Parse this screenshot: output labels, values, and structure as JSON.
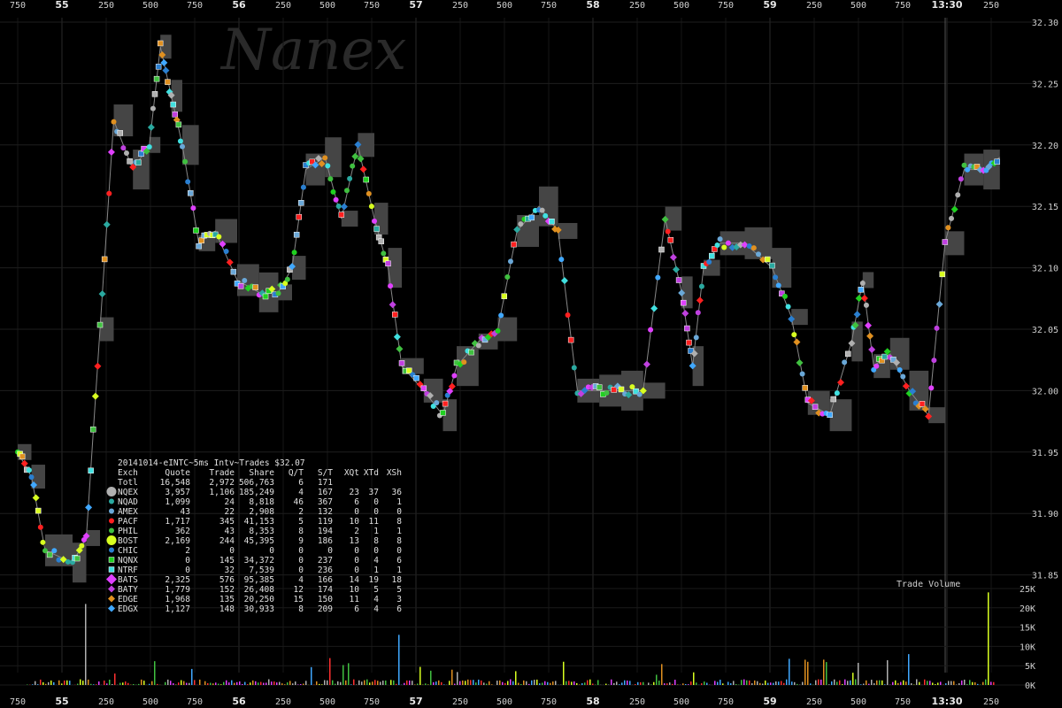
{
  "watermark": "Nanex",
  "chart_data": {
    "type": "scatter",
    "title": "20141014-eINTC~5ms Intv~Trades $32.07",
    "x_axis": {
      "tick_labels": [
        "750",
        "55",
        "250",
        "500",
        "750",
        "56",
        "250",
        "500",
        "750",
        "57",
        "250",
        "500",
        "750",
        "58",
        "250",
        "500",
        "750",
        "59",
        "250",
        "500",
        "750",
        "13:30",
        "250"
      ],
      "major_ticks": [
        "55",
        "56",
        "57",
        "58",
        "59",
        "13:30"
      ]
    },
    "y_axis": {
      "ylim": [
        31.83,
        32.31
      ],
      "tick_labels": [
        "32.30",
        "32.25",
        "32.20",
        "32.15",
        "32.10",
        "32.05",
        "32.00",
        "31.95",
        "31.90",
        "31.85"
      ]
    },
    "volume_panel": {
      "label": "Trade Volume",
      "tick_labels": [
        "25K",
        "20K",
        "15K",
        "10K",
        "5K",
        "0K"
      ],
      "ylim": [
        0,
        25000
      ]
    },
    "price_path": [
      [
        0,
        31.95
      ],
      [
        5,
        31.93
      ],
      [
        10,
        31.87
      ],
      [
        20,
        31.86
      ],
      [
        25,
        31.88
      ],
      [
        30,
        32.05
      ],
      [
        35,
        32.22
      ],
      [
        42,
        32.18
      ],
      [
        48,
        32.2
      ],
      [
        52,
        32.28
      ],
      [
        56,
        32.24
      ],
      [
        60,
        32.2
      ],
      [
        66,
        32.12
      ],
      [
        72,
        32.13
      ],
      [
        80,
        32.09
      ],
      [
        88,
        32.08
      ],
      [
        95,
        32.08
      ],
      [
        100,
        32.1
      ],
      [
        105,
        32.18
      ],
      [
        112,
        32.19
      ],
      [
        118,
        32.14
      ],
      [
        124,
        32.2
      ],
      [
        130,
        32.14
      ],
      [
        135,
        32.1
      ],
      [
        140,
        32.02
      ],
      [
        148,
        32.0
      ],
      [
        155,
        31.98
      ],
      [
        160,
        32.02
      ],
      [
        168,
        32.04
      ],
      [
        175,
        32.05
      ],
      [
        182,
        32.13
      ],
      [
        190,
        32.15
      ],
      [
        197,
        32.13
      ],
      [
        204,
        32.0
      ],
      [
        212,
        32.0
      ],
      [
        220,
        32.0
      ],
      [
        228,
        32.0
      ],
      [
        236,
        32.14
      ],
      [
        242,
        32.08
      ],
      [
        246,
        32.02
      ],
      [
        250,
        32.1
      ],
      [
        256,
        32.12
      ],
      [
        265,
        32.12
      ],
      [
        275,
        32.1
      ],
      [
        282,
        32.06
      ],
      [
        288,
        31.99
      ],
      [
        296,
        31.98
      ],
      [
        304,
        32.04
      ],
      [
        308,
        32.09
      ],
      [
        312,
        32.02
      ],
      [
        318,
        32.03
      ],
      [
        325,
        32.0
      ],
      [
        332,
        31.98
      ],
      [
        338,
        32.12
      ],
      [
        345,
        32.18
      ],
      [
        352,
        32.18
      ],
      [
        358,
        32.19
      ]
    ],
    "legend_table": {
      "columns": [
        "Exch",
        "Quote",
        "Trade",
        "Share",
        "Q/T",
        "S/T",
        "XQt",
        "XTd",
        "XSh"
      ],
      "rows": [
        {
          "label": "Totl",
          "values": [
            "16,548",
            "2,972",
            "506,763",
            "6",
            "171",
            "",
            "",
            ""
          ],
          "color": "",
          "marker": "none"
        },
        {
          "label": "NQEX",
          "values": [
            "3,957",
            "1,106",
            "185,249",
            "4",
            "167",
            "23",
            "37",
            "36"
          ],
          "color": "#b0b0b0",
          "marker": "circle-large"
        },
        {
          "label": "NQAD",
          "values": [
            "1,099",
            "24",
            "8,818",
            "46",
            "367",
            "6",
            "0",
            "1"
          ],
          "color": "#2aa9a0",
          "marker": "circle"
        },
        {
          "label": "AMEX",
          "values": [
            "43",
            "22",
            "2,908",
            "2",
            "132",
            "0",
            "0",
            "0"
          ],
          "color": "#6aa8d8",
          "marker": "circle"
        },
        {
          "label": "PACF",
          "values": [
            "1,717",
            "345",
            "41,153",
            "5",
            "119",
            "10",
            "11",
            "8"
          ],
          "color": "#ff2020",
          "marker": "circle"
        },
        {
          "label": "PHIL",
          "values": [
            "362",
            "43",
            "8,353",
            "8",
            "194",
            "2",
            "1",
            "1"
          ],
          "color": "#40c040",
          "marker": "circle"
        },
        {
          "label": "BOST",
          "values": [
            "2,169",
            "244",
            "45,395",
            "9",
            "186",
            "13",
            "8",
            "8"
          ],
          "color": "#d8ff20",
          "marker": "circle-large"
        },
        {
          "label": "CHIC",
          "values": [
            "2",
            "0",
            "0",
            "0",
            "0",
            "0",
            "0",
            "0"
          ],
          "color": "#2a7fd0",
          "marker": "circle"
        },
        {
          "label": "NQNX",
          "values": [
            "0",
            "145",
            "34,372",
            "0",
            "237",
            "0",
            "4",
            "6"
          ],
          "color": "#20d020",
          "marker": "square"
        },
        {
          "label": "NTRF",
          "values": [
            "0",
            "32",
            "7,539",
            "0",
            "236",
            "0",
            "1",
            "1"
          ],
          "color": "#40e0e0",
          "marker": "square"
        },
        {
          "label": "BATS",
          "values": [
            "2,325",
            "576",
            "95,385",
            "4",
            "166",
            "14",
            "19",
            "18"
          ],
          "color": "#e040ff",
          "marker": "diamond-large"
        },
        {
          "label": "BATY",
          "values": [
            "1,779",
            "152",
            "26,408",
            "12",
            "174",
            "10",
            "5",
            "5"
          ],
          "color": "#c040e0",
          "marker": "diamond"
        },
        {
          "label": "EDGE",
          "values": [
            "1,968",
            "135",
            "20,250",
            "15",
            "150",
            "11",
            "4",
            "3"
          ],
          "color": "#e09020",
          "marker": "diamond"
        },
        {
          "label": "EDGX",
          "values": [
            "1,127",
            "148",
            "30,933",
            "8",
            "209",
            "6",
            "4",
            "6"
          ],
          "color": "#40a8ff",
          "marker": "diamond"
        }
      ]
    },
    "colors": {
      "background": "#000000",
      "nbbo_band": "#454545",
      "grid": "#1e1e1e",
      "text": "#d0d0d0",
      "volume_colors": [
        "#ff3030",
        "#40c040",
        "#e040ff",
        "#b0b0b0",
        "#d8ff20",
        "#40a8ff",
        "#e09020"
      ]
    }
  }
}
